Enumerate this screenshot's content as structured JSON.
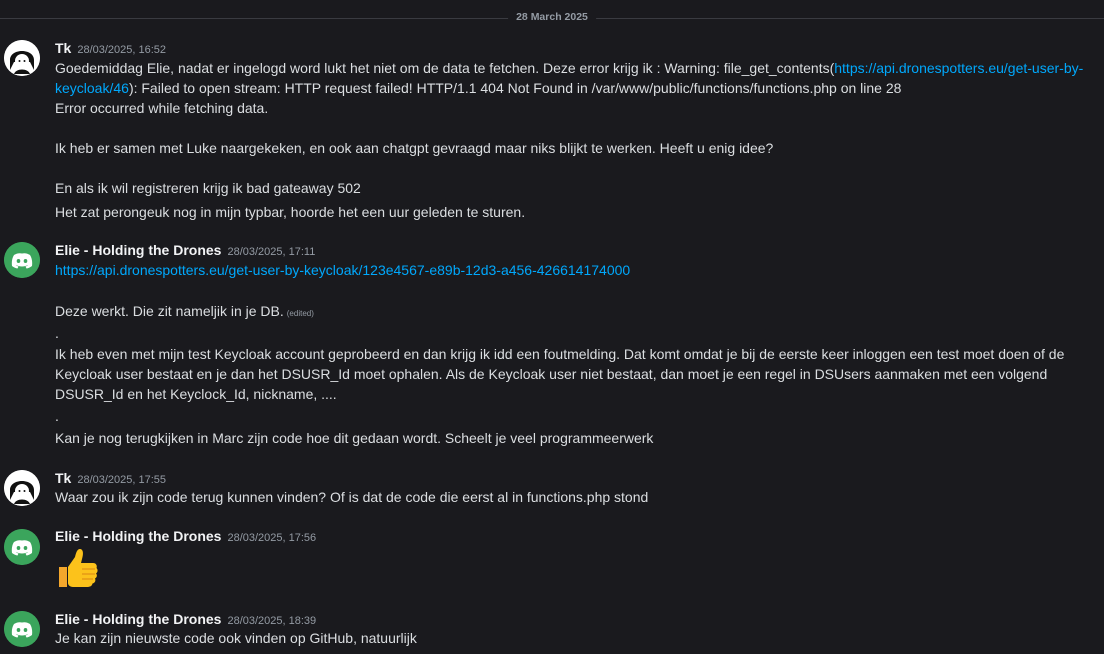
{
  "date_divider": "28 March 2025",
  "messages": [
    {
      "author": "Tk",
      "timestamp": "28/03/2025, 16:52",
      "p1_pre": "Goedemiddag Elie, nadat er ingelogd word lukt het niet om de data te fetchen. Deze error krijg ik : Warning: file_get_contents(",
      "p1_link": "https://api.dronespotters.eu/get-user-by-keycloak/46",
      "p1_post": "): Failed to open stream: HTTP request failed! HTTP/1.1 404 Not Found in /var/www/public/functions/functions.php on line 28",
      "p2": "Error occurred while fetching data.",
      "p3": "Ik heb er samen met Luke naargekeken, en ook aan chatgpt gevraagd maar niks blijkt te werken. Heeft u enig idee?",
      "p4": "En als ik wil registreren krijg ik bad gateaway 502",
      "p5": "Het zat perongeuk nog in mijn typbar, hoorde het een uur geleden te sturen."
    },
    {
      "author": "Elie - Holding the Drones",
      "timestamp": "28/03/2025, 17:11",
      "link": "https://api.dronespotters.eu/get-user-by-keycloak/123e4567-e89b-12d3-a456-426614174000",
      "p1": "Deze werkt. Die zit nameljik in je DB.",
      "edited": "(edited)",
      "dot1": ".",
      "p2": "Ik heb even met mijn test Keycloak account geprobeerd en dan krijg ik idd een foutmelding. Dat komt omdat je bij de eerste keer inloggen een test moet doen of de Keycloak user bestaat en je dan het DSUSR_Id moet ophalen. Als de Keycloak user niet bestaat, dan moet je een regel in DSUsers aanmaken met een volgend DSUSR_Id en het Keyclock_Id, nickname, ....",
      "dot2": ".",
      "p3": "Kan je nog terugkijken in Marc zijn code hoe dit gedaan wordt. Scheelt je veel programmeerwerk"
    },
    {
      "author": "Tk",
      "timestamp": "28/03/2025, 17:55",
      "p1": "Waar zou ik zijn code terug kunnen vinden? Of is dat de code die eerst al in functions.php stond"
    },
    {
      "author": "Elie - Holding the Drones",
      "timestamp": "28/03/2025, 17:56",
      "emoji": "thumbs-up"
    },
    {
      "author": "Elie - Holding the Drones",
      "timestamp": "28/03/2025, 18:39",
      "p1": "Je kan zijn nieuwste code ook vinden op GitHub, natuurlijk"
    }
  ],
  "colors": {
    "background": "#1a1a1e",
    "text": "#dbdee1",
    "muted": "#949ba4",
    "link": "#00a8fc",
    "bot_avatar": "#3ba55c"
  }
}
